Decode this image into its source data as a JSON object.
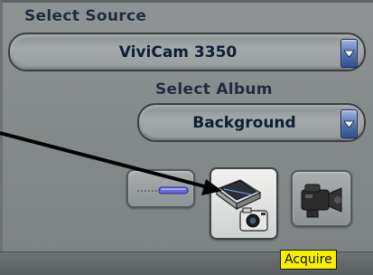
{
  "source": {
    "label": "Select Source",
    "selected": "ViviCam 3350"
  },
  "album": {
    "label": "Select Album",
    "selected": "Background"
  },
  "tools": {
    "buttons": [
      {
        "icon": "pen-icon"
      },
      {
        "icon": "scanner-camera-icon"
      },
      {
        "icon": "video-camera-icon"
      }
    ]
  },
  "tooltip": {
    "text": "Acquire"
  },
  "colors": {
    "accent_blue": "#5270ad",
    "tooltip_bg": "#f4f000",
    "text": "#0f1d33"
  }
}
